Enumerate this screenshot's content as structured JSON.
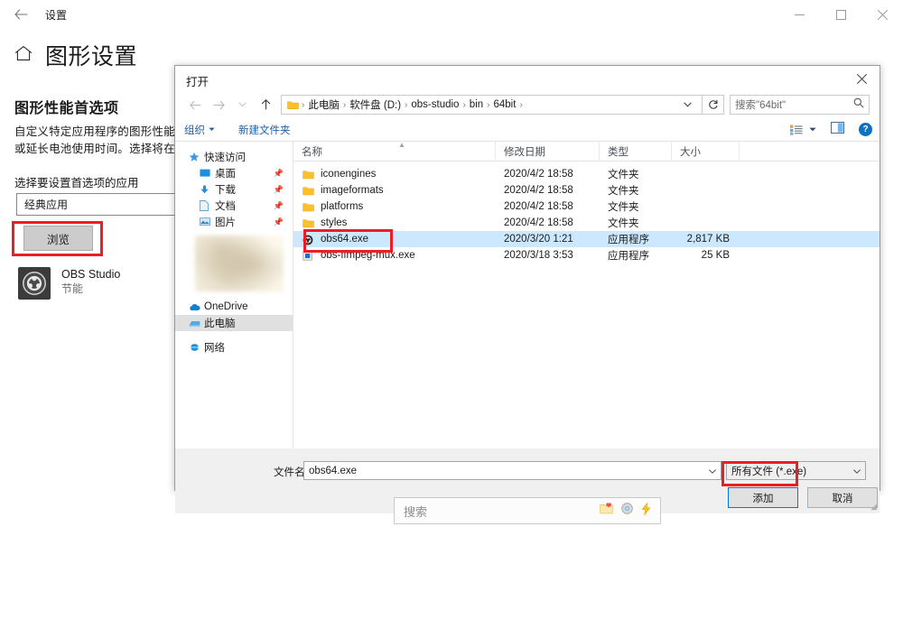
{
  "settings_window": {
    "titlebar": {
      "back_label": "←",
      "title": "设置",
      "minimize": "minimize",
      "maximize": "maximize",
      "close": "close"
    },
    "page_title": "图形设置",
    "section_title": "图形性能首选项",
    "description_line1": "自定义特定应用程序的图形性能首",
    "description_line2": "或延长电池使用时间。选择将在下",
    "field_label": "选择要设置首选项的应用",
    "app_type_value": "经典应用",
    "browse_button": "浏览",
    "app_entry": {
      "name": "OBS Studio",
      "status": "节能"
    }
  },
  "open_dialog": {
    "title": "打开",
    "close_label": "✕",
    "breadcrumb": [
      "此电脑",
      "软件盘 (D:)",
      "obs-studio",
      "bin",
      "64bit"
    ],
    "refresh_label": "↻",
    "search_placeholder": "搜索\"64bit\"",
    "toolbar": {
      "organize": "组织",
      "new_folder": "新建文件夹",
      "help_label": "?"
    },
    "sidebar": [
      {
        "label": "快速访问",
        "icon": "star-icon",
        "level": "root",
        "pinned": false,
        "selected": false
      },
      {
        "label": "桌面",
        "icon": "desktop-icon",
        "level": "child",
        "pinned": true,
        "selected": false
      },
      {
        "label": "下载",
        "icon": "download-icon",
        "level": "child",
        "pinned": true,
        "selected": false
      },
      {
        "label": "文档",
        "icon": "document-icon",
        "level": "child",
        "pinned": true,
        "selected": false
      },
      {
        "label": "图片",
        "icon": "pictures-icon",
        "level": "child",
        "pinned": true,
        "selected": false
      },
      {
        "label": "OneDrive",
        "icon": "cloud-icon",
        "level": "root",
        "pinned": false,
        "selected": false
      },
      {
        "label": "此电脑",
        "icon": "computer-icon",
        "level": "root",
        "pinned": false,
        "selected": true
      },
      {
        "label": "网络",
        "icon": "network-icon",
        "level": "root",
        "pinned": false,
        "selected": false
      }
    ],
    "columns": [
      "名称",
      "修改日期",
      "类型",
      "大小"
    ],
    "files": [
      {
        "name": "iconengines",
        "date": "2020/4/2 18:58",
        "type": "文件夹",
        "size": "",
        "icon": "folder-icon",
        "selected": false
      },
      {
        "name": "imageformats",
        "date": "2020/4/2 18:58",
        "type": "文件夹",
        "size": "",
        "icon": "folder-icon",
        "selected": false
      },
      {
        "name": "platforms",
        "date": "2020/4/2 18:58",
        "type": "文件夹",
        "size": "",
        "icon": "folder-icon",
        "selected": false
      },
      {
        "name": "styles",
        "date": "2020/4/2 18:58",
        "type": "文件夹",
        "size": "",
        "icon": "folder-icon",
        "selected": false
      },
      {
        "name": "obs64.exe",
        "date": "2020/3/20 1:21",
        "type": "应用程序",
        "size": "2,817 KB",
        "icon": "obs-app-icon",
        "selected": true
      },
      {
        "name": "obs-ffmpeg-mux.exe",
        "date": "2020/3/18 3:53",
        "type": "应用程序",
        "size": "25 KB",
        "icon": "exe-icon",
        "selected": false
      }
    ],
    "footer": {
      "filename_label": "文件名(N):",
      "filename_value": "obs64.exe",
      "filter_value": "所有文件 (*.exe)",
      "add_button": "添加",
      "cancel_button": "取消"
    }
  },
  "taskbar_search": {
    "placeholder": "搜索",
    "icons": [
      "folder-heart-icon",
      "disc-icon",
      "lightning-icon"
    ]
  },
  "annotations": {
    "accent_red": "#ee1c25",
    "focus_blue": "#0078d7",
    "selection_blue": "#cce8ff"
  }
}
